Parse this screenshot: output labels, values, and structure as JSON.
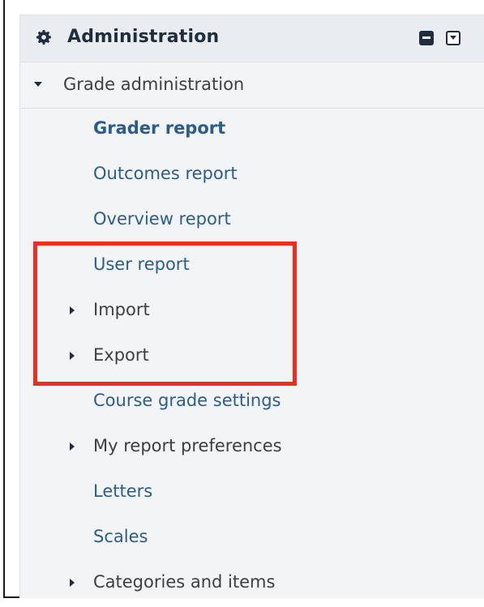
{
  "block": {
    "title": "Administration",
    "icons": {
      "header": "gear-icon",
      "collapse": "collapse-block-icon",
      "dock": "dock-block-icon"
    }
  },
  "section": {
    "label": "Grade administration",
    "expanded": true
  },
  "items": [
    {
      "label": "Grader report",
      "active": true,
      "has_children": false
    },
    {
      "label": "Outcomes report",
      "active": false,
      "has_children": false
    },
    {
      "label": "Overview report",
      "active": false,
      "has_children": false
    },
    {
      "label": "User report",
      "active": false,
      "has_children": false
    },
    {
      "label": "Import",
      "active": false,
      "has_children": true
    },
    {
      "label": "Export",
      "active": false,
      "has_children": true
    },
    {
      "label": "Course grade settings",
      "active": false,
      "has_children": false
    },
    {
      "label": "My report preferences",
      "active": false,
      "has_children": true
    },
    {
      "label": "Letters",
      "active": false,
      "has_children": false
    },
    {
      "label": "Scales",
      "active": false,
      "has_children": false
    },
    {
      "label": "Categories and items",
      "active": false,
      "has_children": true
    }
  ],
  "colors": {
    "link": "#2b5d8c",
    "highlight": "#ef2b22",
    "block_background": "#f2f4f6"
  },
  "annotation": {
    "type": "highlight-box",
    "items_highlighted": [
      "User report",
      "Import",
      "Export"
    ]
  }
}
